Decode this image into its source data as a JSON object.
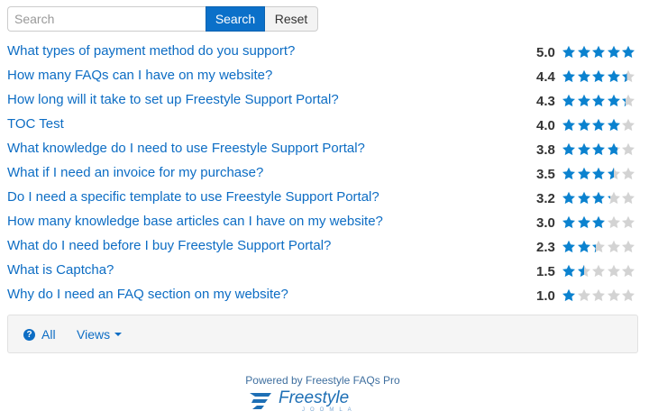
{
  "search": {
    "placeholder": "Search",
    "search_label": "Search",
    "reset_label": "Reset"
  },
  "faqs": [
    {
      "question": "What types of payment method do you support?",
      "rating": "5.0",
      "stars": 5.0
    },
    {
      "question": "How many FAQs can I have on my website?",
      "rating": "4.4",
      "stars": 4.4
    },
    {
      "question": "How long will it take to set up Freestyle Support Portal?",
      "rating": "4.3",
      "stars": 4.3
    },
    {
      "question": "TOC Test",
      "rating": "4.0",
      "stars": 4.0
    },
    {
      "question": "What knowledge do I need to use Freestyle Support Portal?",
      "rating": "3.8",
      "stars": 3.8
    },
    {
      "question": "What if I need an invoice for my purchase?",
      "rating": "3.5",
      "stars": 3.5
    },
    {
      "question": "Do I need a specific template to use Freestyle Support Portal?",
      "rating": "3.2",
      "stars": 3.2
    },
    {
      "question": "How many knowledge base articles can I have on my website?",
      "rating": "3.0",
      "stars": 3.0
    },
    {
      "question": "What do I need before I buy Freestyle Support Portal?",
      "rating": "2.3",
      "stars": 2.3
    },
    {
      "question": "What is Captcha?",
      "rating": "1.5",
      "stars": 1.5
    },
    {
      "question": "Why do I need an FAQ section on my website?",
      "rating": "1.0",
      "stars": 1.0
    }
  ],
  "footer": {
    "all_label": "All",
    "all_icon": "question-circle-icon",
    "views_label": "Views"
  },
  "powered_by": "Powered by Freestyle FAQs Pro",
  "logo": {
    "wordmark": "Freestyle",
    "sub": "JOOMLA"
  },
  "colors": {
    "link": "#0d6dc4",
    "star_on": "#0b82cf",
    "star_off": "#d3d3d3",
    "button": "#0b70c9"
  }
}
